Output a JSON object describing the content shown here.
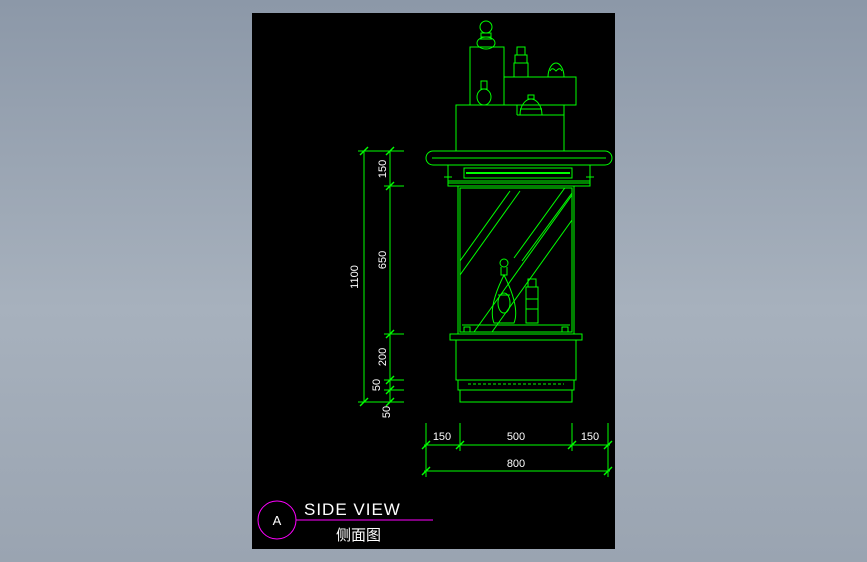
{
  "view": {
    "marker_letter": "A",
    "title_en": "SIDE VIEW",
    "title_zh": "侧面图"
  },
  "dimensions": {
    "vertical_total": "1100",
    "vertical_segments": [
      "150",
      "650",
      "200",
      "50",
      "50"
    ],
    "horizontal_segments": [
      "150",
      "500",
      "150"
    ],
    "horizontal_total": "800"
  },
  "colors": {
    "background": "#000000",
    "outline": "#00ff00",
    "dimension_text": "#ffffff",
    "marker": "#ff00ff"
  }
}
